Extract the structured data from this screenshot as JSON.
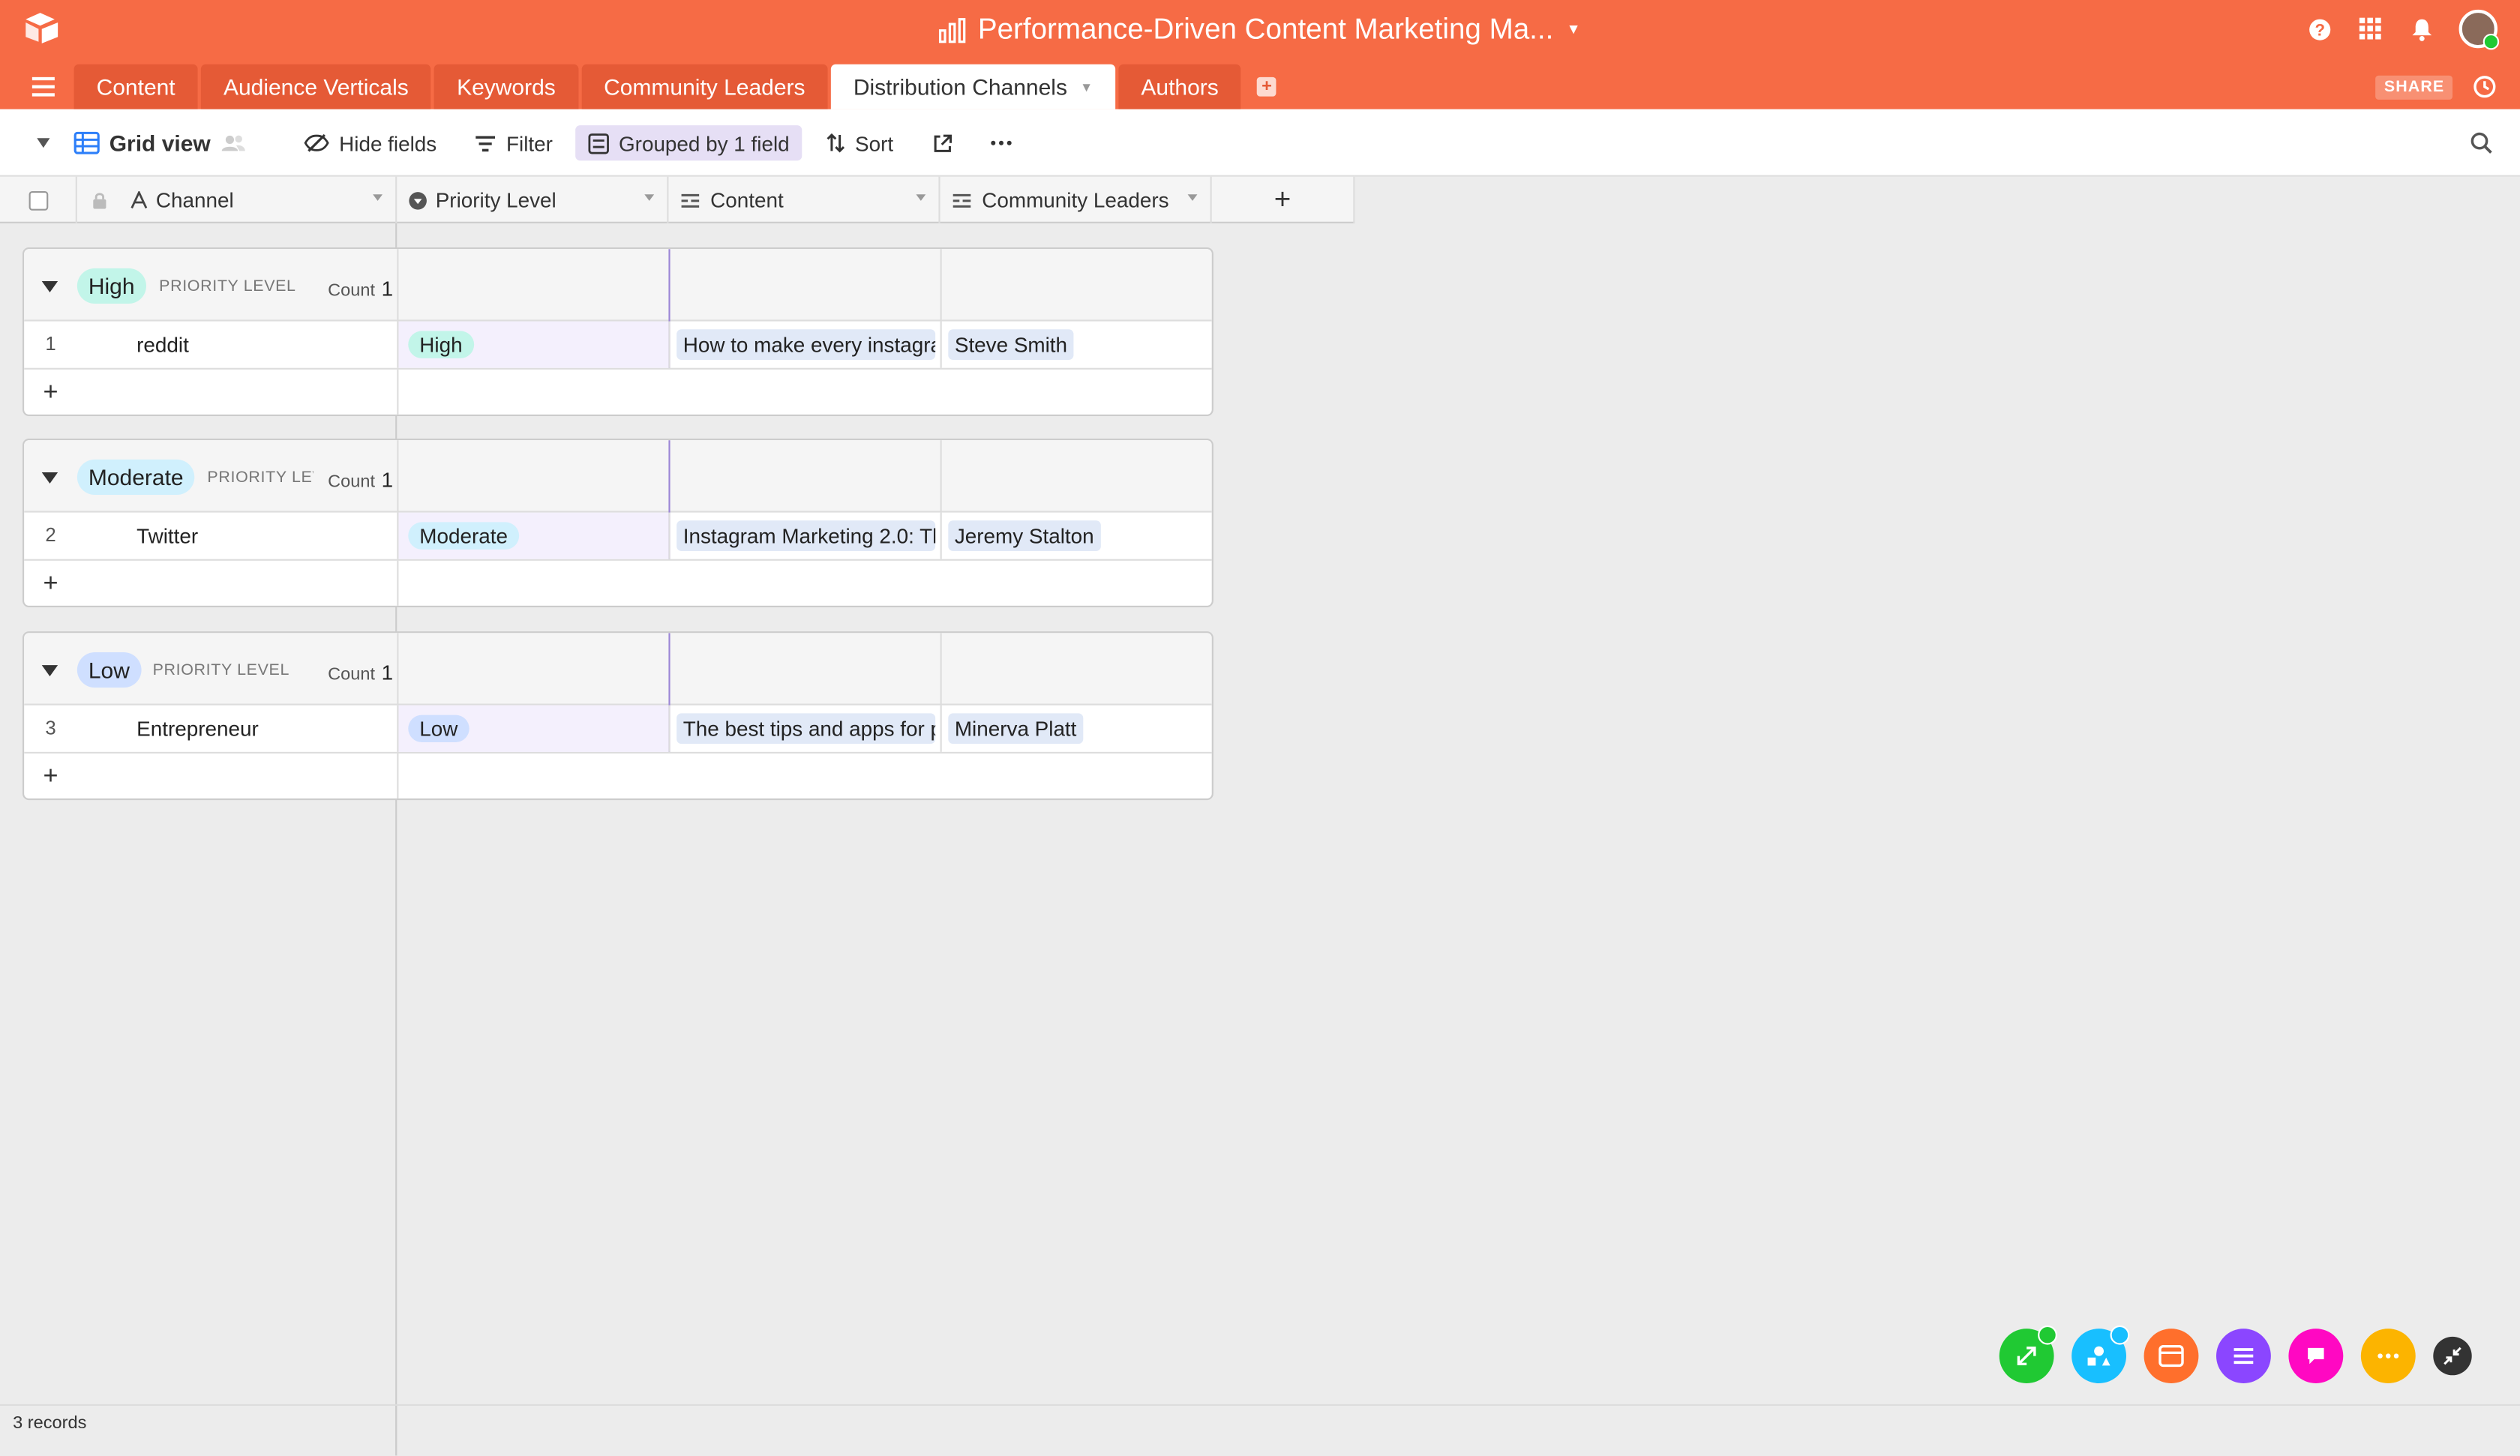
{
  "header": {
    "base_title": "Performance-Driven Content Marketing Ma...",
    "share_label": "SHARE"
  },
  "tabs": [
    {
      "label": "Content"
    },
    {
      "label": "Audience Verticals"
    },
    {
      "label": "Keywords"
    },
    {
      "label": "Community Leaders"
    },
    {
      "label": "Distribution Channels",
      "active": true
    },
    {
      "label": "Authors"
    }
  ],
  "toolbar": {
    "view_name": "Grid view",
    "hide_fields": "Hide fields",
    "filter": "Filter",
    "grouped": "Grouped by 1 field",
    "sort": "Sort"
  },
  "columns": {
    "channel": "Channel",
    "priority": "Priority Level",
    "content": "Content",
    "leaders": "Community Leaders"
  },
  "groups": [
    {
      "value": "High",
      "label": "PRIORITY LEVEL",
      "count_label": "Count",
      "count": "1",
      "row": {
        "num": "1",
        "channel": "reddit",
        "priority": "High",
        "content": "How to make every instagram",
        "leader": "Steve Smith"
      }
    },
    {
      "value": "Moderate",
      "label": "PRIORITY LEVEL",
      "count_label": "Count",
      "count": "1",
      "row": {
        "num": "2",
        "channel": "Twitter",
        "priority": "Moderate",
        "content": "Instagram Marketing 2.0: The",
        "leader": "Jeremy Stalton"
      }
    },
    {
      "value": "Low",
      "label": "PRIORITY LEVEL",
      "count_label": "Count",
      "count": "1",
      "row": {
        "num": "3",
        "channel": "Entrepreneur",
        "priority": "Low",
        "content": "The best tips and apps for p",
        "leader": "Minerva Platt"
      }
    }
  ],
  "footer": {
    "records": "3 records"
  },
  "colors": {
    "brand": "#f66b45",
    "high": "#c2f5e9",
    "moderate": "#d0f0fd",
    "low": "#cfdfff"
  },
  "apps": [
    {
      "icon": "expand-icon",
      "color": "#20c933"
    },
    {
      "icon": "shapes-icon",
      "color": "#18bfff"
    },
    {
      "icon": "image-icon",
      "color": "#ff6f2c"
    },
    {
      "icon": "list-icon",
      "color": "#8b46ff"
    },
    {
      "icon": "chat-icon",
      "color": "#ff08c2"
    },
    {
      "icon": "more-icon",
      "color": "#fcb400"
    },
    {
      "icon": "collapse-icon",
      "color": "#333333"
    }
  ]
}
